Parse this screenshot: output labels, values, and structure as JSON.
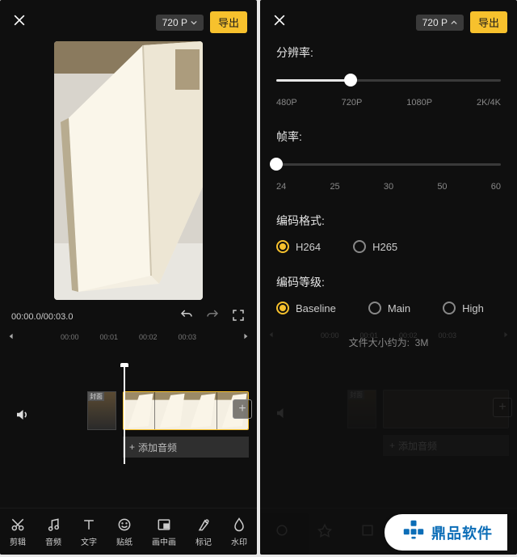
{
  "left": {
    "top": {
      "resolution_badge": "720 P",
      "export": "导出"
    },
    "time": {
      "current": "00:00.0",
      "total": "00:03.0"
    },
    "ruler": [
      "00:00",
      "00:01",
      "00:02",
      "00:03"
    ],
    "timeline": {
      "cover_label": "封面",
      "add_audio": "添加音频",
      "plus_label": "+ 添"
    },
    "tabs": [
      {
        "name": "cut",
        "label": "剪辑"
      },
      {
        "name": "audio",
        "label": "音频"
      },
      {
        "name": "text",
        "label": "文字"
      },
      {
        "name": "sticker",
        "label": "贴纸"
      },
      {
        "name": "pip",
        "label": "画中画"
      },
      {
        "name": "marker",
        "label": "标记"
      },
      {
        "name": "watermark",
        "label": "水印"
      }
    ]
  },
  "right": {
    "top": {
      "resolution_badge": "720 P",
      "export": "导出"
    },
    "resolution": {
      "label": "分辨率:",
      "options": [
        "480P",
        "720P",
        "1080P",
        "2K/4K"
      ],
      "index": 1
    },
    "fps": {
      "label": "帧率:",
      "options": [
        "24",
        "25",
        "30",
        "50",
        "60"
      ],
      "index": 0
    },
    "encoding": {
      "label": "编码格式:",
      "options": [
        "H264",
        "H265"
      ],
      "selected": 0
    },
    "level": {
      "label": "编码等级:",
      "options": [
        "Baseline",
        "Main",
        "High"
      ],
      "selected": 0
    },
    "size_est_label": "文件大小约为:",
    "size_est_value": "3M",
    "dim_tabs": [
      "",
      "",
      "",
      "",
      "",
      ""
    ]
  },
  "watermark": "鼎品软件"
}
